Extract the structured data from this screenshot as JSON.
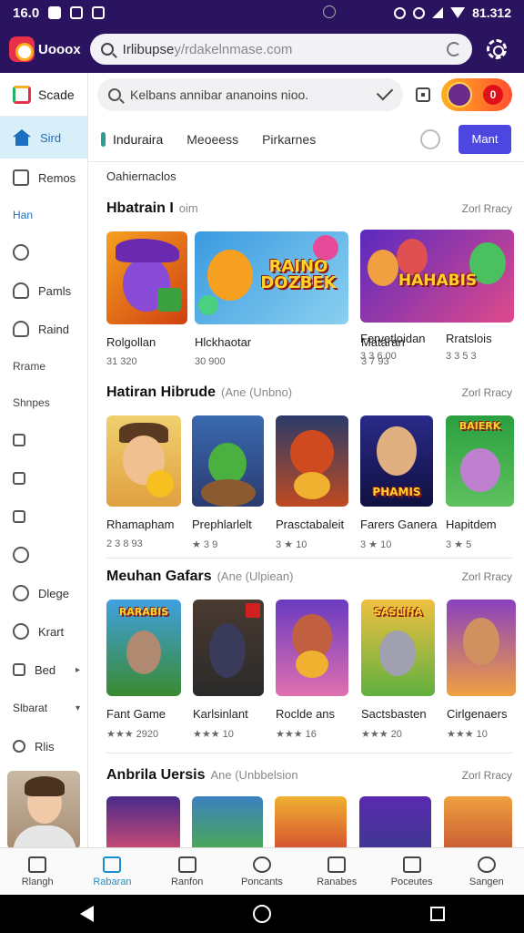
{
  "status_bar": {
    "time": "16.0",
    "right_text": "81.312"
  },
  "browser": {
    "app_name": "Uooox",
    "url_main": "Irlibupse",
    "url_rest": "y/rdakelnmase.com"
  },
  "sidebar": {
    "top_label": "Scade",
    "items": [
      {
        "label": "Sird",
        "icon": "home-icon",
        "active": true
      },
      {
        "label": "Remos",
        "icon": "image-icon"
      }
    ],
    "section1": "Han",
    "items2": [
      {
        "label": "",
        "icon": "clock-icon"
      },
      {
        "label": "Pamls",
        "icon": "person-icon"
      },
      {
        "label": "Raind",
        "icon": "user-icon"
      }
    ],
    "section2": "Rrame",
    "section3": "Shnpes",
    "items3": [
      {
        "label": "",
        "icon": "calendar-icon"
      },
      {
        "label": "",
        "icon": "edit-icon"
      },
      {
        "label": "",
        "icon": "box-icon"
      },
      {
        "label": "",
        "icon": "chat-icon"
      },
      {
        "label": "Dlege",
        "icon": "circle-icon"
      },
      {
        "label": "Krart",
        "icon": "emoji-icon"
      },
      {
        "label": "Bed",
        "icon": "bed-icon"
      }
    ],
    "section4": "Slbarat",
    "items4": [
      {
        "label": "Rlis",
        "icon": "refresh-icon"
      }
    ]
  },
  "search": {
    "placeholder": "Kelbans annibar ananoins nioo."
  },
  "promo_badge": "0",
  "tabs": [
    {
      "label": "Induraira",
      "active": true
    },
    {
      "label": "Meoeess"
    },
    {
      "label": "Pirkarnes"
    }
  ],
  "tab_button": "Mant",
  "subcategory": "Oahiernaclos",
  "sections": [
    {
      "title": "Hbatrain I",
      "sub": "oim",
      "more": "Zorl Rracy",
      "cards": [
        {
          "name": "Rolgollan",
          "meta": "31 320",
          "art_text": ""
        },
        {
          "name": "Hlckhaotar",
          "meta": "30 900",
          "art_text": "RAINO DOZBEK"
        },
        {
          "name": "Mataran",
          "meta": "3 7 93",
          "art_text": ""
        },
        {
          "name": "Fervetloidan",
          "meta": "3 3 6.00",
          "art_text": "HAHABIS"
        },
        {
          "name": "Rratslois",
          "meta": "3 3 5 3",
          "art_text": ""
        }
      ]
    },
    {
      "title": "Hatiran Hibrude",
      "sub": "(Ane (Unbno)",
      "more": "Zorl Rracy",
      "cards": [
        {
          "name": "Rhamapham",
          "meta": "2 3 8 93",
          "art_text": ""
        },
        {
          "name": "Prephlarlelt",
          "meta": "★ 3 9",
          "art_text": ""
        },
        {
          "name": "Prasctabaleit",
          "meta": "3 ★ 10",
          "art_text": ""
        },
        {
          "name": "Farers Ganera",
          "meta": "3 ★ 10",
          "art_text": "PHAMIS"
        },
        {
          "name": "Hapitdem",
          "meta": "3 ★ 5",
          "art_text": "BAIERK"
        }
      ]
    },
    {
      "title": "Meuhan Gafars",
      "sub": "(Ane (Ulpiean)",
      "more": "Zorl Rracy",
      "cards": [
        {
          "name": "Fant Game",
          "meta": "★★★ 2920",
          "art_text": "RARABIS"
        },
        {
          "name": "Karlsinlant",
          "meta": "★★★ 10",
          "art_text": ""
        },
        {
          "name": "Roclde ans",
          "meta": "★★★ 16",
          "art_text": ""
        },
        {
          "name": "Sactsbasten",
          "meta": "★★★ 20",
          "art_text": "SASLIHA"
        },
        {
          "name": "Cirlgenaers",
          "meta": "★★★ 10",
          "art_text": ""
        }
      ]
    },
    {
      "title": "Anbrila Uersis",
      "sub": "Ane (Unbbelsion",
      "more": "Zorl Rracy",
      "cards": []
    }
  ],
  "bottom_nav": [
    {
      "label": "Rlangh",
      "icon": "home-outline-icon"
    },
    {
      "label": "Rabaran",
      "icon": "grid-icon",
      "active": true
    },
    {
      "label": "Ranfon",
      "icon": "store-icon"
    },
    {
      "label": "Poncants",
      "icon": "pin-icon"
    },
    {
      "label": "Ranabes",
      "icon": "table-icon"
    },
    {
      "label": "Poceutes",
      "icon": "gamepad-icon"
    },
    {
      "label": "Sangen",
      "icon": "profile-icon"
    }
  ]
}
